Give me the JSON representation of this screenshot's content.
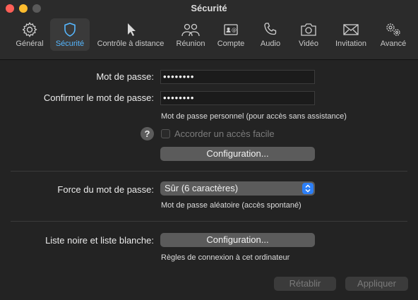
{
  "window": {
    "title": "Sécurité"
  },
  "toolbar": {
    "items": [
      {
        "label": "Général",
        "icon": "gear-icon"
      },
      {
        "label": "Sécurité",
        "icon": "shield-icon",
        "selected": true
      },
      {
        "label": "Contrôle à distance",
        "icon": "cursor-icon"
      },
      {
        "label": "Réunion",
        "icon": "people-icon"
      },
      {
        "label": "Compte",
        "icon": "account-card-icon"
      },
      {
        "label": "Audio",
        "icon": "phone-icon"
      },
      {
        "label": "Vidéo",
        "icon": "camera-icon"
      },
      {
        "label": "Invitation",
        "icon": "envelope-icon"
      },
      {
        "label": "Avancé",
        "icon": "gears-icon"
      }
    ]
  },
  "password": {
    "label": "Mot de passe:",
    "value": "••••••••",
    "confirm_label": "Confirmer le mot de passe:",
    "confirm_value": "••••••••",
    "note": "Mot de passe personnel (pour accès sans assistance)",
    "easy_access_label": "Accorder un accès facile",
    "help": "?",
    "config_button": "Configuration..."
  },
  "strength": {
    "label": "Force du mot de passe:",
    "value": "Sûr (6 caractères)",
    "note": "Mot de passe aléatoire (accès spontané)"
  },
  "lists": {
    "label": "Liste noire et liste blanche:",
    "config_button": "Configuration...",
    "note": "Règles de connexion à cet ordinateur"
  },
  "footer": {
    "reset_button": "Rétablir",
    "apply_button": "Appliquer"
  },
  "colors": {
    "accent": "#56b7ff",
    "popup_arrow": "#2c7ff7"
  }
}
